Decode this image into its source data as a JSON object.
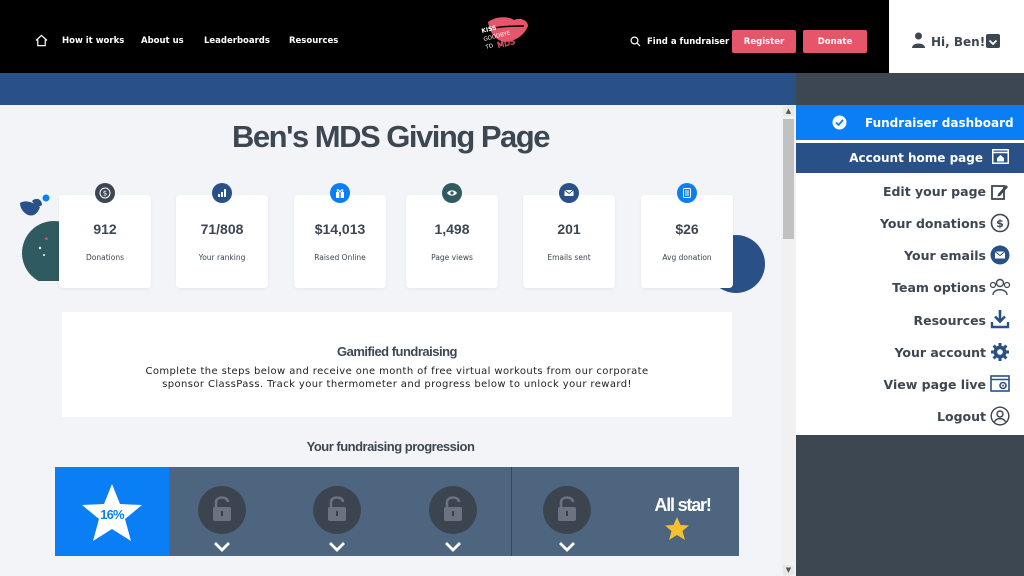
{
  "header": {
    "nav": [
      "How it works",
      "About us",
      "Leaderboards",
      "Resources"
    ],
    "logo_text": [
      "KISS",
      "GOODBYE",
      "TO",
      "MDS"
    ],
    "search_label": "Find a fundraiser",
    "register_label": "Register",
    "donate_label": "Donate",
    "user_greeting": "Hi, Ben!"
  },
  "page": {
    "title": "Ben's MDS Giving Page"
  },
  "stats": [
    {
      "value": "912",
      "label": "Donations",
      "icon": "dollar-icon"
    },
    {
      "value": "71/808",
      "label": "Your ranking",
      "icon": "bar-chart-icon"
    },
    {
      "value": "$14,013",
      "label": "Raised Online",
      "icon": "gift-icon"
    },
    {
      "value": "1,498",
      "label": "Page views",
      "icon": "eye-icon"
    },
    {
      "value": "201",
      "label": "Emails sent",
      "icon": "envelope-icon"
    },
    {
      "value": "$26",
      "label": "Avg donation",
      "icon": "calculator-icon"
    }
  ],
  "gamified": {
    "title": "Gamified fundraising",
    "text": "Complete the steps below and receive one month of free virtual workouts from our corporate sponsor ClassPass. Track your thermometer and progress below to unlock your reward!"
  },
  "progression": {
    "title": "Your fundraising progression",
    "current_percent_label": "16%",
    "progress_fraction": 0.16,
    "final_label": "All star!"
  },
  "sidebar": {
    "dashboard_label": "Fundraiser dashboard",
    "items": [
      {
        "label": "Account home page",
        "icon": "browser-home-icon"
      },
      {
        "label": "Edit your page",
        "icon": "edit-icon"
      },
      {
        "label": "Your donations",
        "icon": "dollar-icon"
      },
      {
        "label": "Your emails",
        "icon": "envelope-icon"
      },
      {
        "label": "Team options",
        "icon": "team-icon"
      },
      {
        "label": "Resources",
        "icon": "download-icon"
      },
      {
        "label": "Your account",
        "icon": "gear-icon"
      },
      {
        "label": "View page live",
        "icon": "browser-settings-icon"
      },
      {
        "label": "Logout",
        "icon": "user-circle-icon"
      }
    ]
  },
  "colors": {
    "header_bg": "#000000",
    "accent_pink": "#e5566b",
    "brand_blue": "#2a5187",
    "dash_blue": "#0a7ff5",
    "dark_slate": "#3d4752",
    "progress_bg": "#4e6580"
  }
}
